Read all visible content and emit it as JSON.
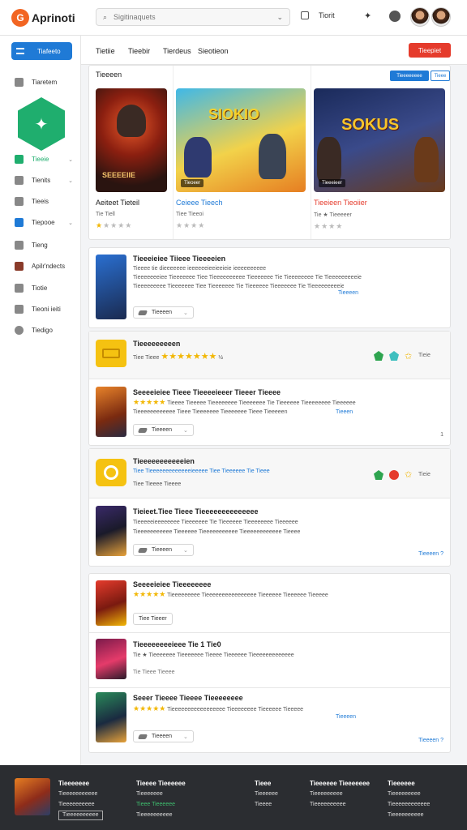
{
  "header": {
    "logo_mark": "G",
    "logo_text": "Aprinoti",
    "logo_sub": "GAMES",
    "search_placeholder": "Sigitinaquets",
    "action_label": "Tiorit"
  },
  "sidebar": {
    "top_button": "Tiafeeto",
    "items": [
      {
        "label": "Tiaretem",
        "icon": "home-icon"
      },
      {
        "label": "Tieeie",
        "icon": "gamepad-icon",
        "chev": "⌄"
      },
      {
        "label": "Tienits",
        "icon": "shield-icon",
        "chev": "⌄"
      },
      {
        "label": "Tieeis",
        "icon": "controller-icon"
      },
      {
        "label": "Tiepooe",
        "icon": "monitor-icon",
        "chev": "⌄"
      },
      {
        "label": "Tieng",
        "icon": "heart-icon"
      },
      {
        "label": "Apilr'ndects",
        "icon": "app-icon"
      },
      {
        "label": "Tiotie",
        "icon": "chat-icon"
      },
      {
        "label": "Tieoni ieiti",
        "icon": "list-icon"
      },
      {
        "label": "Tiedigo",
        "icon": "globe-icon"
      }
    ]
  },
  "tabs": [
    "Tietiie",
    "Tieebir",
    "Tierdeus",
    "Sieotieon"
  ],
  "red_button": "Tieepiet",
  "featured": {
    "heading": "Tieeeen",
    "pill_primary": "Tieeeeeeee",
    "pill_secondary": "Tieee",
    "items": [
      {
        "title": "Aeiteet Tieteil",
        "meta": "Tie Tiell",
        "stars": "★★★★",
        "badge": "Seesaie",
        "art": "SEEEEIIE"
      },
      {
        "title": "Ceieee Tieech",
        "meta": "Tiee Tieeoi",
        "stars": "★★★★",
        "badge": "Tieoeer",
        "art": "SIOKIO"
      },
      {
        "title": "Tieeieen Tieoiier",
        "meta": "Tie ★ Tieeeeer",
        "stars": "★★★★",
        "badge": "Tieeeieer",
        "art": "SOKUS"
      }
    ]
  },
  "list1": {
    "title": "Tieeeieiee Tiieee Tieeeeien",
    "lines": [
      "Tieeee tie dieeeeeee ieeeeeeieeieeieie ieeeeeeeeee",
      "Tieeeeeeeiee Tieeeeeee Tiee Tieeeeeeeeee Tieeeeeee Tie Tieeeeeeee Tie Tieeeeeeeeeie",
      "Tieeeeeeeee Tieeeeeee Tiee Tieeeeeee Tie Tieeeeee Tieeeeeee Tie Tieeeeeeeeeie"
    ],
    "link": "Tieeeen",
    "button": "Tieeeen"
  },
  "group2": {
    "header_title": "Tieeeeeeeeen",
    "header_meta": "Tiee Tieee",
    "header_right": "Tieie",
    "row_title": "Seeeeieiee Tieee Tieeeeieeer Tieeer Tieeee",
    "row_lines": [
      "Tieeee Tieeeee Tieeeeeeee Tieeeeeee Tie Tieeeeee Tieeeeeeee Tieeeeee",
      "Tieeeeeeeeeeee Tieee Tieeeeeee Tieeeeeee Tieee Tieeeeen"
    ],
    "link": "Tieeen",
    "button": "Tieeeen",
    "page": "1"
  },
  "group3": {
    "header_title": "Tieeeeeeeeeeeien",
    "header_meta": "Tiee Tieeeeeeeeeeeeeieeeee Tiee Tieeeeee Tie Tieee",
    "header_sub": "Tiee Tieeee Tieeee",
    "header_right": "Tieie",
    "row_title": "Tieieet.Tiee Tieee Tieeeeeeeeeeeeee",
    "row_lines": [
      "Tieeeeeieeeeeeee Tieeeeeee Tie Tieeeeee Tieeeeeeee Tieeeeee",
      "Tieeeeeeeeeee Tieeeeee Tieeeeeeeeeee Tieeeeeeeeeeee Tieeee"
    ],
    "button": "Tieeeen",
    "more": "Tieeeen ?"
  },
  "list4": [
    {
      "title": "Seeeeieiee Tieeeeeeee",
      "sub": "Tieeeeeeeee Tieeeeeeeeeeeeeeee Tieeeeee Tieeeeee Tieeeee",
      "button": "Tiee Tieeer"
    },
    {
      "title": "Tieeeeeeeeieee Tie 1 Tie0",
      "sub": "Tie ★ Tieeeeeee Tieeeeeee Tieeee Tieeeeee Tieeeeeeeeeeeee",
      "meta": "Tie Tieee Tieeee"
    },
    {
      "title": "Seeer Tieeee Tieeee Tieeeeeeee",
      "sub": "Tieeeeeeeeeeeeeeeee Tieeeeeeee Tieeeeee Tieeeee",
      "link": "Tieeeen",
      "button": "Tieeeen"
    }
  ],
  "list4_more": "Tieeeen ?",
  "footer": {
    "col1": {
      "title": "Tieeeeeee",
      "lines": [
        "Tieeeeeeeeeee",
        "Tieeeeeeeeee"
      ],
      "button": "Tieeeeeeeeee"
    },
    "col2": {
      "title": "Tieeee Tieeeeee",
      "lines": [
        "Tieeeeeee",
        "Tieee Tieeeeee",
        "Tieeeeeeeeee"
      ]
    },
    "col3": {
      "title": "Tieee",
      "lines": [
        "Tieeeeee",
        "Tieeee"
      ]
    },
    "col4": {
      "title": "Tieeeeee Tieeeeeee",
      "lines": [
        "Tieeeeeeeee",
        "Tieeeeeeeeee"
      ]
    },
    "col5": {
      "title": "Tieeeeee",
      "lines": [
        "Tieeeeeeeee",
        "Tieeeeeeeeeeee",
        "Tieeeeeeeeee"
      ]
    }
  },
  "colors": {
    "accent": "#1f7ad6",
    "brand": "#f26522",
    "danger": "#e53b2c",
    "star": "#f2b705",
    "hex": "#1fae6e"
  }
}
